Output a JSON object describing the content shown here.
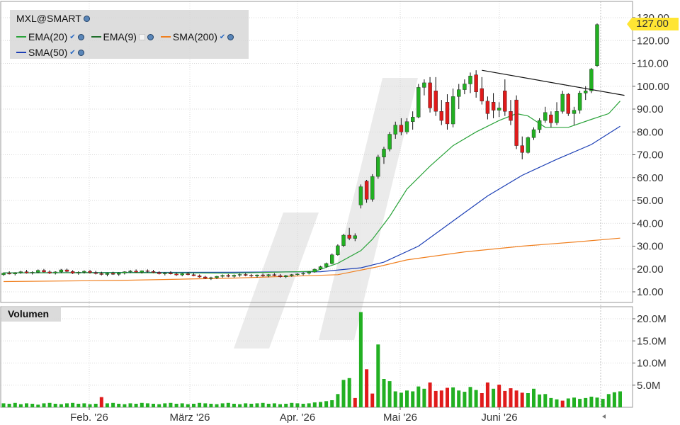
{
  "legend": {
    "symbol": "MXL@SMART",
    "indicators": [
      {
        "label": "EMA(20)",
        "color": "#2aa33a"
      },
      {
        "label": "EMA(9)",
        "color": "#1f6e2a"
      },
      {
        "label": "SMA(200)",
        "color": "#f07f1e"
      },
      {
        "label": "SMA(50)",
        "color": "#1c3fb5"
      }
    ]
  },
  "volume_label": "Volumen",
  "last_price_label": "127.00",
  "chart_data": [
    {
      "type": "candlestick",
      "price_axis": {
        "ticks": [
          "10.00",
          "20.00",
          "30.00",
          "40.00",
          "50.00",
          "60.00",
          "70.00",
          "80.00",
          "90.00",
          "100.00",
          "110.00",
          "120.00",
          "130.00"
        ],
        "ylim": [
          5,
          133
        ]
      },
      "x_tick_labels": [
        "Feb. '26",
        "März '26",
        "Apr. '26",
        "Mai '26",
        "Juni '26"
      ],
      "colors": {
        "up": "#22b022",
        "down": "#e01b1b"
      },
      "candles": [
        [
          17.5,
          18.5,
          17.0,
          18.2
        ],
        [
          18.2,
          19.0,
          17.6,
          17.8
        ],
        [
          17.8,
          18.6,
          17.2,
          18.4
        ],
        [
          18.4,
          19.2,
          17.9,
          18.8
        ],
        [
          18.8,
          19.6,
          18.0,
          18.3
        ],
        [
          18.3,
          19.0,
          17.6,
          18.6
        ],
        [
          18.6,
          19.8,
          18.2,
          19.4
        ],
        [
          19.4,
          20.0,
          18.5,
          18.7
        ],
        [
          18.7,
          19.4,
          17.8,
          18.2
        ],
        [
          18.2,
          19.0,
          17.6,
          18.7
        ],
        [
          18.7,
          20.0,
          18.2,
          19.6
        ],
        [
          19.6,
          20.2,
          18.6,
          18.9
        ],
        [
          18.9,
          19.5,
          17.8,
          18.2
        ],
        [
          18.2,
          19.0,
          17.5,
          18.6
        ],
        [
          18.6,
          19.4,
          18.0,
          19.0
        ],
        [
          19.0,
          19.6,
          18.0,
          18.4
        ],
        [
          18.4,
          19.2,
          17.6,
          18.0
        ],
        [
          18.0,
          18.8,
          17.2,
          17.6
        ],
        [
          17.6,
          18.4,
          16.8,
          18.1
        ],
        [
          18.1,
          18.8,
          17.4,
          17.7
        ],
        [
          17.7,
          18.5,
          17.0,
          18.2
        ],
        [
          18.2,
          19.0,
          17.6,
          18.8
        ],
        [
          18.8,
          19.6,
          18.2,
          19.1
        ],
        [
          19.1,
          19.8,
          18.4,
          18.6
        ],
        [
          18.6,
          19.4,
          18.0,
          19.2
        ],
        [
          19.2,
          19.8,
          18.4,
          18.9
        ],
        [
          18.9,
          19.6,
          18.2,
          18.5
        ],
        [
          18.5,
          19.0,
          17.6,
          17.9
        ],
        [
          17.9,
          18.6,
          17.2,
          18.3
        ],
        [
          18.3,
          19.0,
          17.6,
          17.8
        ],
        [
          17.8,
          18.4,
          17.0,
          17.4
        ],
        [
          17.4,
          18.2,
          16.8,
          17.9
        ],
        [
          17.9,
          18.6,
          17.2,
          17.5
        ],
        [
          17.5,
          18.2,
          16.8,
          17.0
        ],
        [
          17.0,
          17.6,
          16.2,
          16.5
        ],
        [
          16.5,
          17.0,
          15.6,
          15.9
        ],
        [
          15.9,
          16.6,
          15.2,
          16.2
        ],
        [
          16.2,
          17.0,
          15.6,
          16.8
        ],
        [
          16.8,
          17.6,
          16.2,
          17.2
        ],
        [
          17.2,
          17.8,
          16.4,
          16.8
        ],
        [
          16.8,
          17.6,
          16.2,
          17.3
        ],
        [
          17.3,
          18.0,
          16.6,
          17.6
        ],
        [
          17.6,
          18.2,
          16.8,
          17.2
        ],
        [
          17.2,
          17.8,
          16.4,
          16.9
        ],
        [
          16.9,
          17.6,
          16.2,
          17.4
        ],
        [
          17.4,
          18.0,
          16.6,
          17.0
        ],
        [
          17.0,
          17.8,
          16.4,
          17.5
        ],
        [
          17.5,
          18.2,
          16.8,
          17.1
        ],
        [
          17.1,
          17.8,
          16.2,
          16.6
        ],
        [
          16.6,
          17.4,
          16.0,
          17.1
        ],
        [
          17.1,
          17.8,
          16.6,
          17.5
        ],
        [
          17.5,
          18.2,
          17.0,
          17.8
        ],
        [
          17.8,
          18.6,
          17.2,
          18.1
        ],
        [
          18.1,
          19.0,
          17.6,
          18.7
        ],
        [
          18.7,
          20.2,
          18.4,
          19.9
        ],
        [
          19.9,
          21.4,
          19.6,
          21.0
        ],
        [
          21.0,
          22.8,
          20.6,
          22.4
        ],
        [
          22.4,
          26.8,
          22.0,
          26.2
        ],
        [
          26.2,
          30.8,
          25.8,
          30.2
        ],
        [
          30.2,
          35.4,
          29.6,
          34.8
        ],
        [
          34.8,
          38.0,
          32.6,
          33.4
        ],
        [
          33.4,
          35.6,
          32.2,
          34.6
        ],
        [
          48.0,
          57.0,
          46.5,
          56.0
        ],
        [
          58.5,
          59.0,
          49.0,
          50.5
        ],
        [
          50.5,
          61.5,
          49.5,
          60.5
        ],
        [
          60.5,
          70.0,
          59.5,
          69.0
        ],
        [
          69.0,
          73.5,
          66.0,
          72.5
        ],
        [
          72.5,
          80.0,
          71.5,
          79.0
        ],
        [
          79.0,
          84.5,
          77.0,
          83.0
        ],
        [
          83.0,
          86.0,
          78.5,
          80.0
        ],
        [
          80.0,
          86.0,
          79.0,
          84.5
        ],
        [
          84.5,
          89.0,
          81.0,
          86.5
        ],
        [
          86.5,
          101.0,
          86.0,
          99.5
        ],
        [
          99.5,
          103.0,
          96.0,
          101.5
        ],
        [
          101.5,
          104.0,
          88.5,
          90.5
        ],
        [
          98.0,
          104.0,
          87.0,
          89.0
        ],
        [
          89.0,
          94.0,
          83.0,
          85.0
        ],
        [
          93.0,
          96.5,
          81.0,
          83.5
        ],
        [
          83.5,
          99.0,
          82.0,
          95.5
        ],
        [
          95.5,
          101.0,
          90.0,
          98.5
        ],
        [
          98.5,
          103.0,
          96.5,
          101.0
        ],
        [
          101.0,
          106.0,
          97.0,
          104.5
        ],
        [
          105.0,
          107.0,
          95.0,
          97.5
        ],
        [
          99.0,
          104.0,
          92.0,
          93.5
        ],
        [
          93.5,
          95.5,
          85.5,
          88.0
        ],
        [
          93.0,
          97.0,
          86.0,
          89.5
        ],
        [
          89.5,
          93.0,
          86.5,
          90.5
        ],
        [
          98.0,
          103.0,
          87.0,
          89.0
        ],
        [
          89.0,
          94.0,
          83.0,
          85.0
        ],
        [
          94.0,
          96.0,
          72.5,
          74.0
        ],
        [
          74.0,
          78.0,
          68.0,
          71.0
        ],
        [
          71.0,
          78.0,
          70.5,
          77.5
        ],
        [
          77.5,
          82.0,
          76.5,
          81.0
        ],
        [
          81.0,
          86.0,
          79.5,
          85.0
        ],
        [
          85.0,
          91.0,
          84.0,
          88.5
        ],
        [
          87.5,
          89.0,
          82.0,
          84.0
        ],
        [
          84.0,
          93.0,
          83.0,
          89.0
        ],
        [
          89.0,
          98.0,
          88.0,
          96.5
        ],
        [
          96.5,
          97.0,
          87.0,
          88.0
        ],
        [
          88.0,
          91.0,
          83.0,
          89.5
        ],
        [
          89.5,
          98.0,
          88.0,
          97.0
        ],
        [
          97.0,
          100.0,
          94.0,
          98.0
        ],
        [
          98.0,
          108.0,
          97.0,
          107.5
        ],
        [
          109.0,
          127.5,
          108.5,
          127.0
        ]
      ],
      "ema20": [
        [
          0,
          18.3
        ],
        [
          20,
          18.4
        ],
        [
          40,
          18.2
        ],
        [
          54,
          19.0
        ],
        [
          58,
          22.5
        ],
        [
          62,
          28.0
        ],
        [
          64,
          33.0
        ],
        [
          67,
          43.0
        ],
        [
          70,
          55.0
        ],
        [
          74,
          65.0
        ],
        [
          78,
          74.0
        ],
        [
          82,
          80.0
        ],
        [
          86,
          85.0
        ],
        [
          89,
          88.0
        ],
        [
          91,
          87.0
        ],
        [
          94,
          82.0
        ],
        [
          98,
          82.0
        ],
        [
          102,
          85.5
        ],
        [
          105,
          88.0
        ],
        [
          107,
          93.5
        ]
      ],
      "ema9": [
        [
          0,
          18.6
        ],
        [
          18,
          18.8
        ],
        [
          36,
          17.8
        ],
        [
          52,
          18.2
        ],
        [
          56,
          21.0
        ],
        [
          60,
          27.0
        ],
        [
          64,
          35.0
        ],
        [
          66,
          44.0
        ],
        [
          69,
          58.0
        ],
        [
          73,
          72.0
        ],
        [
          77,
          82.0
        ],
        [
          81,
          90.0
        ],
        [
          85,
          94.0
        ],
        [
          89,
          93.0
        ],
        [
          92,
          88.0
        ],
        [
          95,
          82.0
        ],
        [
          99,
          84.0
        ],
        [
          103,
          89.0
        ],
        [
          106,
          96.0
        ],
        [
          107,
          100.0
        ]
      ],
      "sma200": [
        [
          0,
          14.5
        ],
        [
          20,
          15.0
        ],
        [
          40,
          16.0
        ],
        [
          58,
          17.5
        ],
        [
          65,
          21.0
        ],
        [
          70,
          24.0
        ],
        [
          80,
          27.5
        ],
        [
          90,
          30.0
        ],
        [
          100,
          32.0
        ],
        [
          107,
          33.5
        ]
      ],
      "sma50": [
        [
          0,
          18.3
        ],
        [
          20,
          18.5
        ],
        [
          40,
          18.6
        ],
        [
          55,
          18.8
        ],
        [
          62,
          20.5
        ],
        [
          66,
          23.0
        ],
        [
          72,
          30.0
        ],
        [
          78,
          41.0
        ],
        [
          84,
          52.0
        ],
        [
          90,
          61.0
        ],
        [
          96,
          68.0
        ],
        [
          102,
          74.5
        ],
        [
          107,
          82.5
        ]
      ],
      "trendline": {
        "from": [
          83,
          107.0
        ],
        "to": [
          107,
          96.0
        ]
      }
    },
    {
      "type": "bar",
      "series_name": "Volumen",
      "y_axis": {
        "ticks": [
          "5.0M",
          "10.0M",
          "15.0M",
          "20.0M"
        ],
        "ylim": [
          0,
          22
        ]
      },
      "values": [
        0.9,
        0.8,
        1.0,
        0.7,
        0.9,
        0.8,
        0.6,
        0.9,
        1.0,
        0.8,
        0.7,
        0.9,
        1.0,
        0.8,
        0.9,
        0.7,
        0.8,
        2.3,
        0.9,
        1.0,
        0.8,
        0.7,
        0.9,
        0.8,
        1.0,
        0.9,
        0.8,
        0.7,
        0.9,
        1.0,
        0.8,
        0.9,
        0.7,
        0.8,
        1.0,
        0.9,
        0.8,
        0.7,
        0.9,
        1.0,
        0.8,
        0.7,
        0.9,
        0.8,
        0.9,
        1.0,
        0.8,
        0.9,
        0.7,
        0.8,
        1.0,
        0.9,
        0.8,
        0.9,
        1.1,
        1.2,
        1.4,
        1.6,
        3.0,
        6.2,
        6.6,
        2.1,
        21.5,
        8.6,
        3.1,
        14.2,
        6.4,
        5.9,
        3.6,
        3.3,
        3.8,
        3.6,
        4.7,
        4.2,
        5.6,
        3.7,
        3.8,
        4.4,
        4.5,
        3.8,
        3.5,
        4.6,
        3.9,
        3.2,
        5.6,
        4.2,
        5.1,
        3.7,
        4.3,
        3.8,
        3.3,
        3.2,
        4.2,
        2.9,
        3.0,
        2.1,
        1.8,
        1.5,
        2.0,
        2.2,
        1.9,
        2.1,
        2.4,
        2.2,
        1.9,
        3.0,
        3.4,
        3.6
      ],
      "down_indices": [
        17,
        61,
        63,
        64,
        74,
        75,
        76,
        77,
        83,
        84,
        86,
        87,
        88,
        89,
        90,
        97
      ]
    }
  ]
}
